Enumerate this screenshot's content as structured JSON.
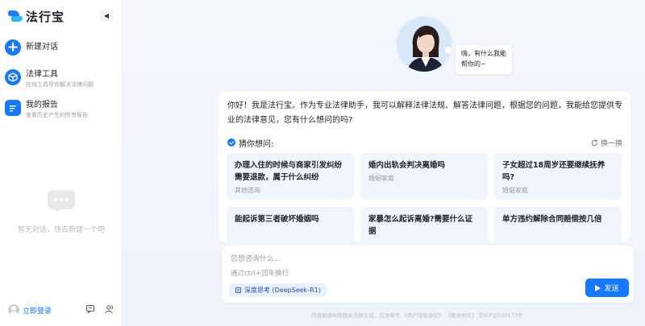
{
  "app": {
    "name": "法行宝"
  },
  "sidebar": {
    "new_chat": "新建对话",
    "items": [
      {
        "title": "法律工具",
        "subtitle": "在线工具帮你解决法律问题",
        "icon": "scale-icon"
      },
      {
        "title": "我的报告",
        "subtitle": "查看历史产生的所有报告",
        "icon": "report-icon"
      }
    ],
    "empty_text": "暂无对话，快去新建一个吧",
    "login": "立即登录"
  },
  "assistant": {
    "greeting": "嗨，有什么我能帮你的~",
    "intro": "你好！我是法行宝。作为专业法律助手，我可以解释法律法规、解答法律问题，根据您的问题，我能给您提供专业的法律意见，您有什么想问的吗?"
  },
  "suggestions": {
    "label": "猜你想问:",
    "refresh": "换一换",
    "questions": [
      {
        "text": "办理入住的时候与商家引发纠纷需要退款，属于什么纠纷",
        "tag": "其他咨询"
      },
      {
        "text": "婚内出轨会判决离婚吗",
        "tag": "婚姻家庭"
      },
      {
        "text": "子女超过18周岁还要继续抚养吗?",
        "tag": "婚姻家庭"
      },
      {
        "text": "能起诉第三者破坏婚姻吗",
        "tag": ""
      },
      {
        "text": "家暴怎么起诉离婚?需要什么证据",
        "tag": ""
      },
      {
        "text": "单方违约解除合同赔偿按几倍",
        "tag": ""
      }
    ]
  },
  "composer": {
    "placeholder": "您想咨询什么...",
    "hint": "通过ctrl+回车换行",
    "deep_think": "深度思考 (DeepSeek-R1)",
    "send": "发送"
  },
  "footer": {
    "disclaimer": "内容依据AI和相关法律生成，仅供参考 《用户隐私协议》 《服务协议》 京ICP证030173号"
  },
  "colors": {
    "accent": "#1677ff",
    "background": "#f3f7fd"
  }
}
